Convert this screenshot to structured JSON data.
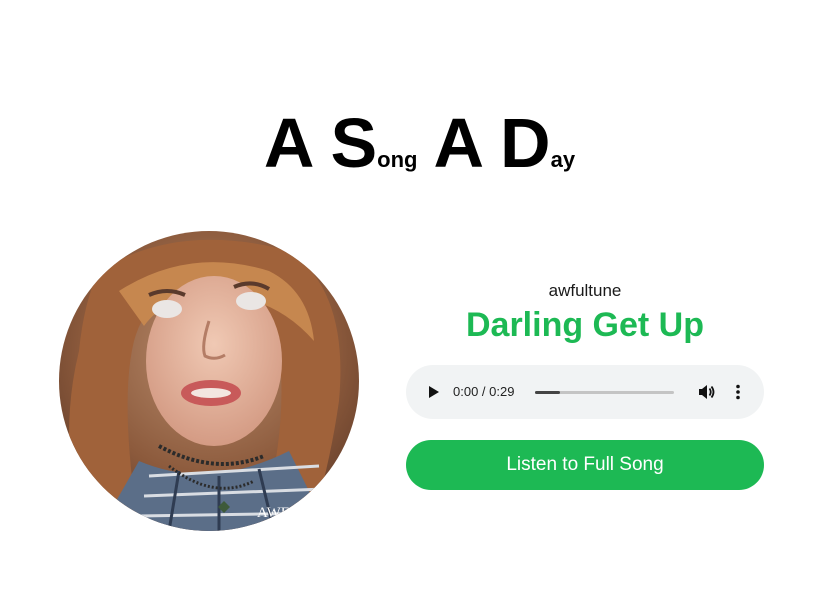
{
  "site": {
    "title_parts": [
      {
        "big": "A",
        "small": ""
      },
      {
        "big": "S",
        "small": "ong"
      },
      {
        "big": "A",
        "small": ""
      },
      {
        "big": "D",
        "small": "ay"
      }
    ]
  },
  "artwork": {
    "watermark": "AWF"
  },
  "track": {
    "artist": "awfultune",
    "title": "Darling Get Up"
  },
  "player": {
    "time_display": "0:00 / 0:29",
    "progress": 0.18,
    "play_icon": "play-icon",
    "volume_icon": "volume-icon",
    "menu_icon": "more-vertical-icon"
  },
  "cta": {
    "label": "Listen to Full Song"
  },
  "colors": {
    "accent": "#1db954",
    "player_bg": "#f1f3f4"
  }
}
